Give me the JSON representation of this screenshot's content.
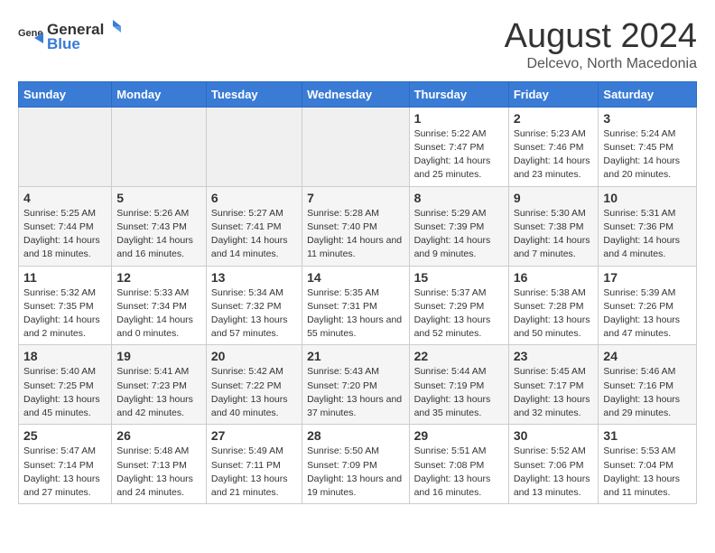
{
  "header": {
    "logo_general": "General",
    "logo_blue": "Blue",
    "main_title": "August 2024",
    "subtitle": "Delcevo, North Macedonia"
  },
  "weekdays": [
    "Sunday",
    "Monday",
    "Tuesday",
    "Wednesday",
    "Thursday",
    "Friday",
    "Saturday"
  ],
  "weeks": [
    {
      "days": [
        {
          "num": "",
          "empty": true
        },
        {
          "num": "",
          "empty": true
        },
        {
          "num": "",
          "empty": true
        },
        {
          "num": "",
          "empty": true
        },
        {
          "num": "1",
          "sunrise": "5:22 AM",
          "sunset": "7:47 PM",
          "daylight": "14 hours and 25 minutes."
        },
        {
          "num": "2",
          "sunrise": "5:23 AM",
          "sunset": "7:46 PM",
          "daylight": "14 hours and 23 minutes."
        },
        {
          "num": "3",
          "sunrise": "5:24 AM",
          "sunset": "7:45 PM",
          "daylight": "14 hours and 20 minutes."
        }
      ]
    },
    {
      "days": [
        {
          "num": "4",
          "sunrise": "5:25 AM",
          "sunset": "7:44 PM",
          "daylight": "14 hours and 18 minutes."
        },
        {
          "num": "5",
          "sunrise": "5:26 AM",
          "sunset": "7:43 PM",
          "daylight": "14 hours and 16 minutes."
        },
        {
          "num": "6",
          "sunrise": "5:27 AM",
          "sunset": "7:41 PM",
          "daylight": "14 hours and 14 minutes."
        },
        {
          "num": "7",
          "sunrise": "5:28 AM",
          "sunset": "7:40 PM",
          "daylight": "14 hours and 11 minutes."
        },
        {
          "num": "8",
          "sunrise": "5:29 AM",
          "sunset": "7:39 PM",
          "daylight": "14 hours and 9 minutes."
        },
        {
          "num": "9",
          "sunrise": "5:30 AM",
          "sunset": "7:38 PM",
          "daylight": "14 hours and 7 minutes."
        },
        {
          "num": "10",
          "sunrise": "5:31 AM",
          "sunset": "7:36 PM",
          "daylight": "14 hours and 4 minutes."
        }
      ]
    },
    {
      "days": [
        {
          "num": "11",
          "sunrise": "5:32 AM",
          "sunset": "7:35 PM",
          "daylight": "14 hours and 2 minutes."
        },
        {
          "num": "12",
          "sunrise": "5:33 AM",
          "sunset": "7:34 PM",
          "daylight": "14 hours and 0 minutes."
        },
        {
          "num": "13",
          "sunrise": "5:34 AM",
          "sunset": "7:32 PM",
          "daylight": "13 hours and 57 minutes."
        },
        {
          "num": "14",
          "sunrise": "5:35 AM",
          "sunset": "7:31 PM",
          "daylight": "13 hours and 55 minutes."
        },
        {
          "num": "15",
          "sunrise": "5:37 AM",
          "sunset": "7:29 PM",
          "daylight": "13 hours and 52 minutes."
        },
        {
          "num": "16",
          "sunrise": "5:38 AM",
          "sunset": "7:28 PM",
          "daylight": "13 hours and 50 minutes."
        },
        {
          "num": "17",
          "sunrise": "5:39 AM",
          "sunset": "7:26 PM",
          "daylight": "13 hours and 47 minutes."
        }
      ]
    },
    {
      "days": [
        {
          "num": "18",
          "sunrise": "5:40 AM",
          "sunset": "7:25 PM",
          "daylight": "13 hours and 45 minutes."
        },
        {
          "num": "19",
          "sunrise": "5:41 AM",
          "sunset": "7:23 PM",
          "daylight": "13 hours and 42 minutes."
        },
        {
          "num": "20",
          "sunrise": "5:42 AM",
          "sunset": "7:22 PM",
          "daylight": "13 hours and 40 minutes."
        },
        {
          "num": "21",
          "sunrise": "5:43 AM",
          "sunset": "7:20 PM",
          "daylight": "13 hours and 37 minutes."
        },
        {
          "num": "22",
          "sunrise": "5:44 AM",
          "sunset": "7:19 PM",
          "daylight": "13 hours and 35 minutes."
        },
        {
          "num": "23",
          "sunrise": "5:45 AM",
          "sunset": "7:17 PM",
          "daylight": "13 hours and 32 minutes."
        },
        {
          "num": "24",
          "sunrise": "5:46 AM",
          "sunset": "7:16 PM",
          "daylight": "13 hours and 29 minutes."
        }
      ]
    },
    {
      "days": [
        {
          "num": "25",
          "sunrise": "5:47 AM",
          "sunset": "7:14 PM",
          "daylight": "13 hours and 27 minutes."
        },
        {
          "num": "26",
          "sunrise": "5:48 AM",
          "sunset": "7:13 PM",
          "daylight": "13 hours and 24 minutes."
        },
        {
          "num": "27",
          "sunrise": "5:49 AM",
          "sunset": "7:11 PM",
          "daylight": "13 hours and 21 minutes."
        },
        {
          "num": "28",
          "sunrise": "5:50 AM",
          "sunset": "7:09 PM",
          "daylight": "13 hours and 19 minutes."
        },
        {
          "num": "29",
          "sunrise": "5:51 AM",
          "sunset": "7:08 PM",
          "daylight": "13 hours and 16 minutes."
        },
        {
          "num": "30",
          "sunrise": "5:52 AM",
          "sunset": "7:06 PM",
          "daylight": "13 hours and 13 minutes."
        },
        {
          "num": "31",
          "sunrise": "5:53 AM",
          "sunset": "7:04 PM",
          "daylight": "13 hours and 11 minutes."
        }
      ]
    }
  ]
}
